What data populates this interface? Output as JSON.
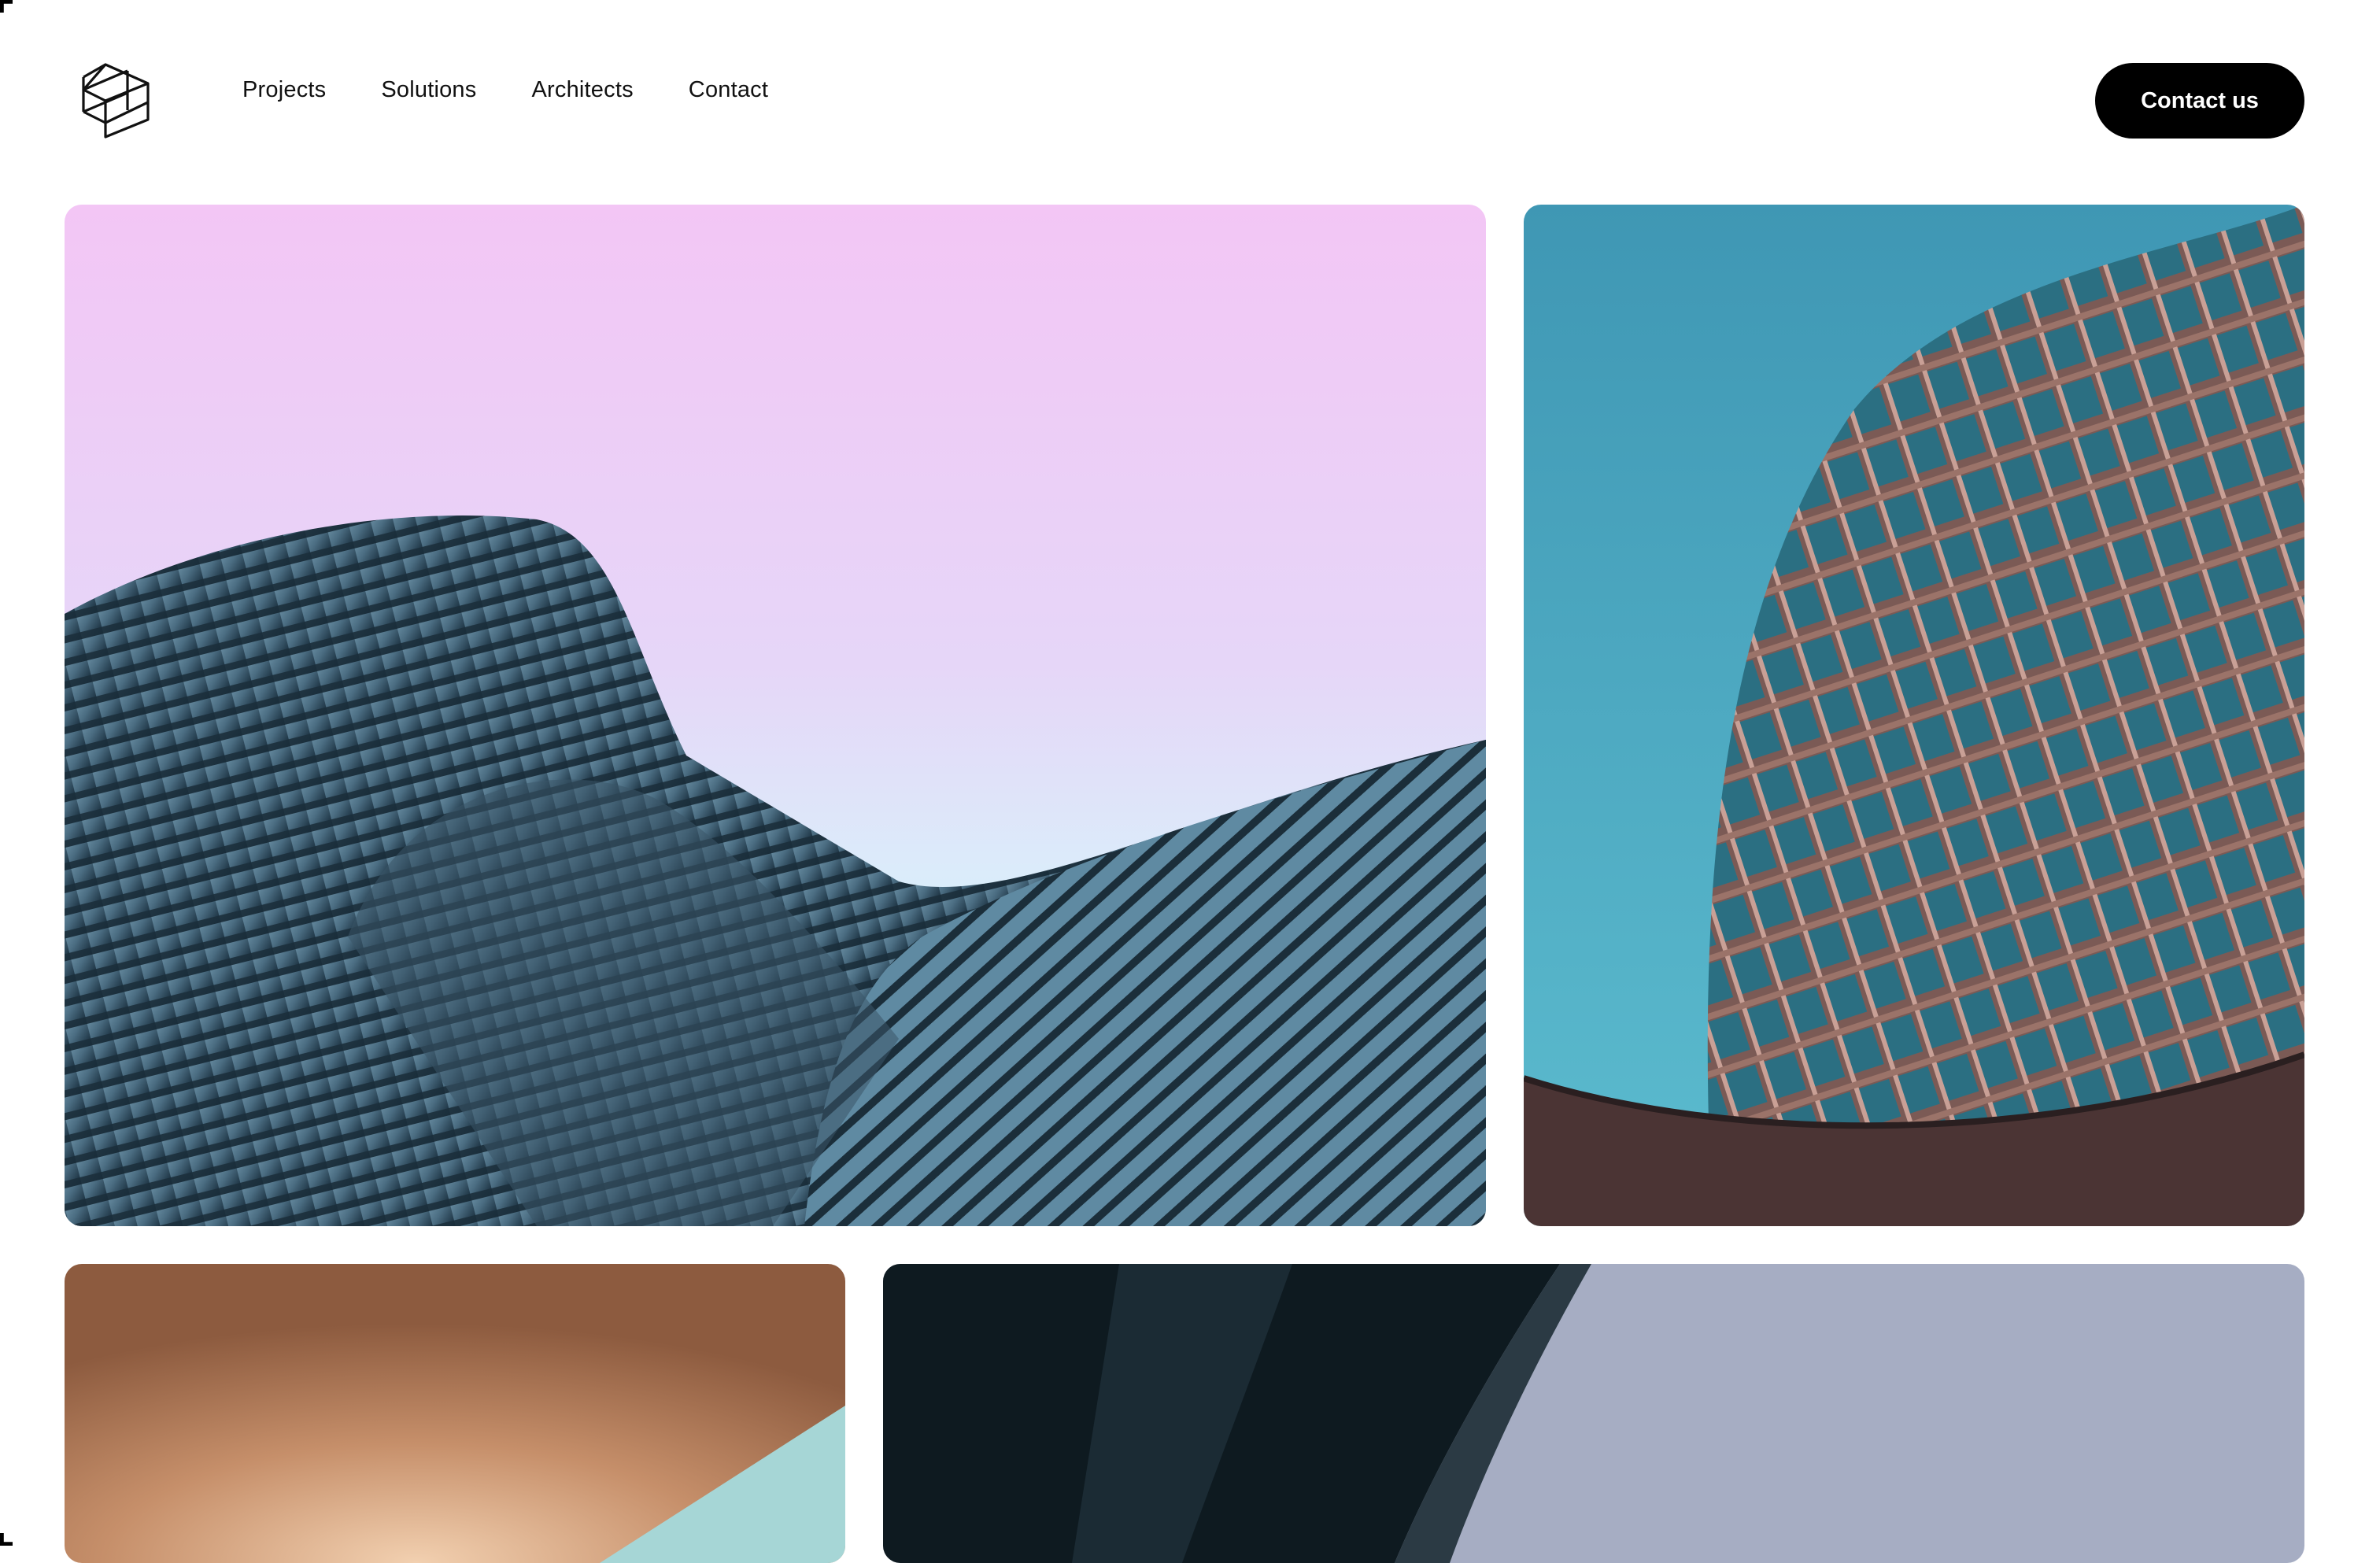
{
  "brand": {
    "logo_icon": "isometric-cube-logo-icon"
  },
  "nav": {
    "items": [
      {
        "label": "Projects"
      },
      {
        "label": "Solutions"
      },
      {
        "label": "Architects"
      },
      {
        "label": "Contact"
      }
    ]
  },
  "header": {
    "cta_label": "Contact us"
  },
  "gallery": {
    "images": [
      {
        "subject": "curved-glass-building-photo",
        "sky_top": "#f3c6f5",
        "sky_bottom": "#d3fbfb"
      },
      {
        "subject": "round-tower-facade-photo",
        "sky": "#4aa6c0"
      },
      {
        "subject": "copper-ceiling-photo",
        "accent": "#a6d6d6"
      },
      {
        "subject": "dark-sculptural-building-photo",
        "sky": "#a6adc3"
      }
    ]
  },
  "colors": {
    "background": "#ffffff",
    "cta_background": "#000000",
    "text": "#111111"
  }
}
